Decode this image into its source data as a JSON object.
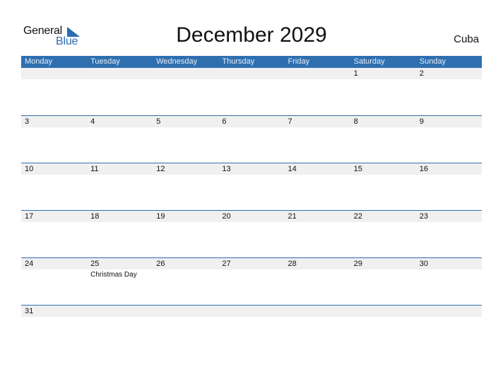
{
  "logo": {
    "general": "General",
    "blue": "Blue",
    "icon": "triangle-flag-icon"
  },
  "title": "December 2029",
  "country": "Cuba",
  "colors": {
    "accent": "#2e6fb0",
    "strip": "#f0f0f0"
  },
  "weekdays": [
    "Monday",
    "Tuesday",
    "Wednesday",
    "Thursday",
    "Friday",
    "Saturday",
    "Sunday"
  ],
  "weeks": [
    {
      "days": [
        "",
        "",
        "",
        "",
        "",
        "1",
        "2"
      ],
      "holidays": [
        "",
        "",
        "",
        "",
        "",
        "",
        ""
      ]
    },
    {
      "days": [
        "3",
        "4",
        "5",
        "6",
        "7",
        "8",
        "9"
      ],
      "holidays": [
        "",
        "",
        "",
        "",
        "",
        "",
        ""
      ]
    },
    {
      "days": [
        "10",
        "11",
        "12",
        "13",
        "14",
        "15",
        "16"
      ],
      "holidays": [
        "",
        "",
        "",
        "",
        "",
        "",
        ""
      ]
    },
    {
      "days": [
        "17",
        "18",
        "19",
        "20",
        "21",
        "22",
        "23"
      ],
      "holidays": [
        "",
        "",
        "",
        "",
        "",
        "",
        ""
      ]
    },
    {
      "days": [
        "24",
        "25",
        "26",
        "27",
        "28",
        "29",
        "30"
      ],
      "holidays": [
        "",
        "Christmas Day",
        "",
        "",
        "",
        "",
        ""
      ]
    },
    {
      "days": [
        "31",
        "",
        "",
        "",
        "",
        "",
        ""
      ],
      "holidays": [
        "",
        "",
        "",
        "",
        "",
        "",
        ""
      ]
    }
  ]
}
